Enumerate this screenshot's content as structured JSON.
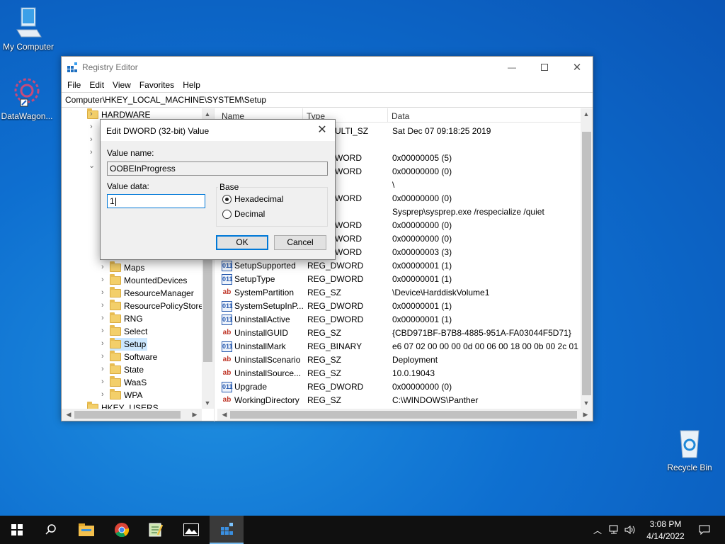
{
  "desktop": {
    "icons": [
      {
        "label": "My Computer"
      },
      {
        "label": "DataWagon..."
      },
      {
        "label": "Recycle Bin"
      }
    ]
  },
  "window": {
    "title": "Registry Editor",
    "menu": [
      "File",
      "Edit",
      "View",
      "Favorites",
      "Help"
    ],
    "address": "Computer\\HKEY_LOCAL_MACHINE\\SYSTEM\\Setup",
    "tree": {
      "top": "HARDWARE",
      "items": [
        "Maps",
        "MountedDevices",
        "ResourceManager",
        "ResourcePolicyStore",
        "RNG",
        "Select",
        "Setup",
        "Software",
        "State",
        "WaaS",
        "WPA"
      ],
      "bottom": "HKEY_USERS",
      "selected": "Setup"
    },
    "columns": {
      "name": "Name",
      "type": "Type",
      "data": "Data"
    },
    "partial_rows": [
      {
        "type": "ULTI_SZ",
        "data": "Sat Dec 07 09:18:25 2019"
      },
      {
        "type": "",
        "data": ""
      },
      {
        "type": "WORD",
        "data": "0x00000005 (5)"
      },
      {
        "type": "WORD",
        "data": "0x00000000 (0)"
      },
      {
        "type": "",
        "data": "\\"
      },
      {
        "type": "WORD",
        "data": "0x00000000 (0)"
      },
      {
        "type": "",
        "data": "Sysprep\\sysprep.exe /respecialize /quiet"
      },
      {
        "type": "WORD",
        "data": "0x00000000 (0)"
      },
      {
        "type": "WORD",
        "data": "0x00000000 (0)"
      },
      {
        "type": "WORD",
        "data": "0x00000003 (3)"
      }
    ],
    "rows": [
      {
        "icon": "binary-value-icon",
        "name": "SetupSupported",
        "type": "REG_DWORD",
        "data": "0x00000001 (1)"
      },
      {
        "icon": "binary-value-icon",
        "name": "SetupType",
        "type": "REG_DWORD",
        "data": "0x00000001 (1)"
      },
      {
        "icon": "string-value-icon",
        "name": "SystemPartition",
        "type": "REG_SZ",
        "data": "\\Device\\HarddiskVolume1"
      },
      {
        "icon": "binary-value-icon",
        "name": "SystemSetupInP...",
        "type": "REG_DWORD",
        "data": "0x00000001 (1)"
      },
      {
        "icon": "binary-value-icon",
        "name": "UninstallActive",
        "type": "REG_DWORD",
        "data": "0x00000001 (1)"
      },
      {
        "icon": "string-value-icon",
        "name": "UninstallGUID",
        "type": "REG_SZ",
        "data": "{CBD971BF-B7B8-4885-951A-FA03044F5D71}"
      },
      {
        "icon": "binary-value-icon",
        "name": "UninstallMark",
        "type": "REG_BINARY",
        "data": "e6 07 02 00 00 00 0d 00 06 00 18 00 0b 00 2c 01"
      },
      {
        "icon": "string-value-icon",
        "name": "UninstallScenario",
        "type": "REG_SZ",
        "data": "Deployment"
      },
      {
        "icon": "string-value-icon",
        "name": "UninstallSource...",
        "type": "REG_SZ",
        "data": "10.0.19043"
      },
      {
        "icon": "binary-value-icon",
        "name": "Upgrade",
        "type": "REG_DWORD",
        "data": "0x00000000 (0)"
      },
      {
        "icon": "string-value-icon",
        "name": "WorkingDirectory",
        "type": "REG_SZ",
        "data": "C:\\WINDOWS\\Panther"
      }
    ]
  },
  "dialog": {
    "title": "Edit DWORD (32-bit) Value",
    "value_name_label": "Value name:",
    "value_name": "OOBEInProgress",
    "value_data_label": "Value data:",
    "value_data": "1",
    "base_label": "Base",
    "hex_label": "Hexadecimal",
    "dec_label": "Decimal",
    "selected_base": "Hexadecimal",
    "ok_label": "OK",
    "cancel_label": "Cancel"
  },
  "taskbar": {
    "time": "3:08 PM",
    "date": "4/14/2022"
  },
  "colors": {
    "accent": "#0078d7",
    "desktop": "#0a5fc4",
    "taskbar": "#101010"
  }
}
